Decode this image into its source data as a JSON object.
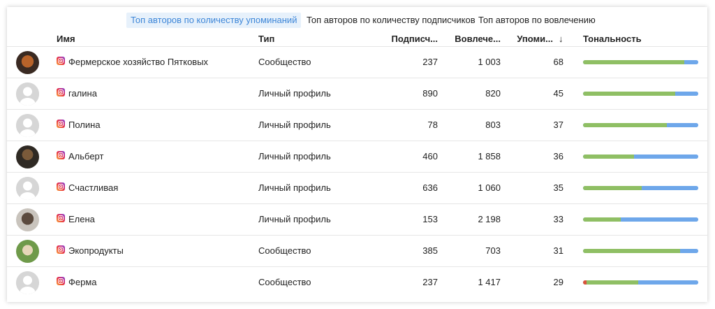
{
  "tabs": [
    {
      "label": "Топ авторов по количеству упоминаний",
      "active": true
    },
    {
      "label": "Топ авторов по количеству подписчиков",
      "active": false
    },
    {
      "label": "Топ авторов по вовлечению",
      "active": false
    }
  ],
  "columns": {
    "name": "Имя",
    "type": "Тип",
    "subscribers": "Подписч...",
    "engagement": "Вовлече...",
    "mentions": "Упоми...",
    "sort_icon": "↓",
    "tone": "Тональность"
  },
  "colors": {
    "positive": "#8fbf64",
    "neutral": "#6ea7ea",
    "negative": "#d9533b",
    "active_tab": "#3d86d8"
  },
  "rows": [
    {
      "name": "Фермерское хозяйство Пятковых",
      "type": "Сообщество",
      "subscribers": "237",
      "engagement": "1 003",
      "mentions": "68",
      "avatar": "photo",
      "tone": {
        "negative": 0,
        "positive": 0.88
      }
    },
    {
      "name": "галина",
      "type": "Личный профиль",
      "subscribers": "890",
      "engagement": "820",
      "mentions": "45",
      "avatar": "placeholder",
      "tone": {
        "negative": 0,
        "positive": 0.8
      }
    },
    {
      "name": "Полина",
      "type": "Личный профиль",
      "subscribers": "78",
      "engagement": "803",
      "mentions": "37",
      "avatar": "placeholder",
      "tone": {
        "negative": 0,
        "positive": 0.73
      }
    },
    {
      "name": "Альберт",
      "type": "Личный профиль",
      "subscribers": "460",
      "engagement": "1 858",
      "mentions": "36",
      "avatar": "photo",
      "tone": {
        "negative": 0,
        "positive": 0.44
      }
    },
    {
      "name": "Счастливая",
      "type": "Личный профиль",
      "subscribers": "636",
      "engagement": "1 060",
      "mentions": "35",
      "avatar": "placeholder",
      "tone": {
        "negative": 0,
        "positive": 0.51
      }
    },
    {
      "name": "Елена",
      "type": "Личный профиль",
      "subscribers": "153",
      "engagement": "2 198",
      "mentions": "33",
      "avatar": "photo",
      "tone": {
        "negative": 0,
        "positive": 0.33
      }
    },
    {
      "name": "Экопродукты",
      "type": "Сообщество",
      "subscribers": "385",
      "engagement": "703",
      "mentions": "31",
      "avatar": "photo",
      "tone": {
        "negative": 0,
        "positive": 0.84
      }
    },
    {
      "name": "Ферма",
      "type": "Сообщество",
      "subscribers": "237",
      "engagement": "1 417",
      "mentions": "29",
      "avatar": "placeholder",
      "tone": {
        "negative": 0.03,
        "positive": 0.45
      }
    }
  ]
}
